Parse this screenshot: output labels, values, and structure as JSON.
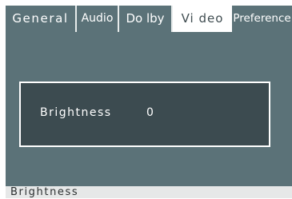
{
  "tabs": [
    {
      "label": "General"
    },
    {
      "label": "Audio"
    },
    {
      "label": "Do lby"
    },
    {
      "label": "Vi deo"
    },
    {
      "label": "Preference"
    }
  ],
  "active_tab": "Vi deo",
  "setting": {
    "label": "Brightness",
    "value": "0"
  },
  "status_bar": {
    "text": "Brightness"
  },
  "colors": {
    "panel": "#5b7278",
    "box": "#3c4b50",
    "active_tab": "#ffffff"
  }
}
